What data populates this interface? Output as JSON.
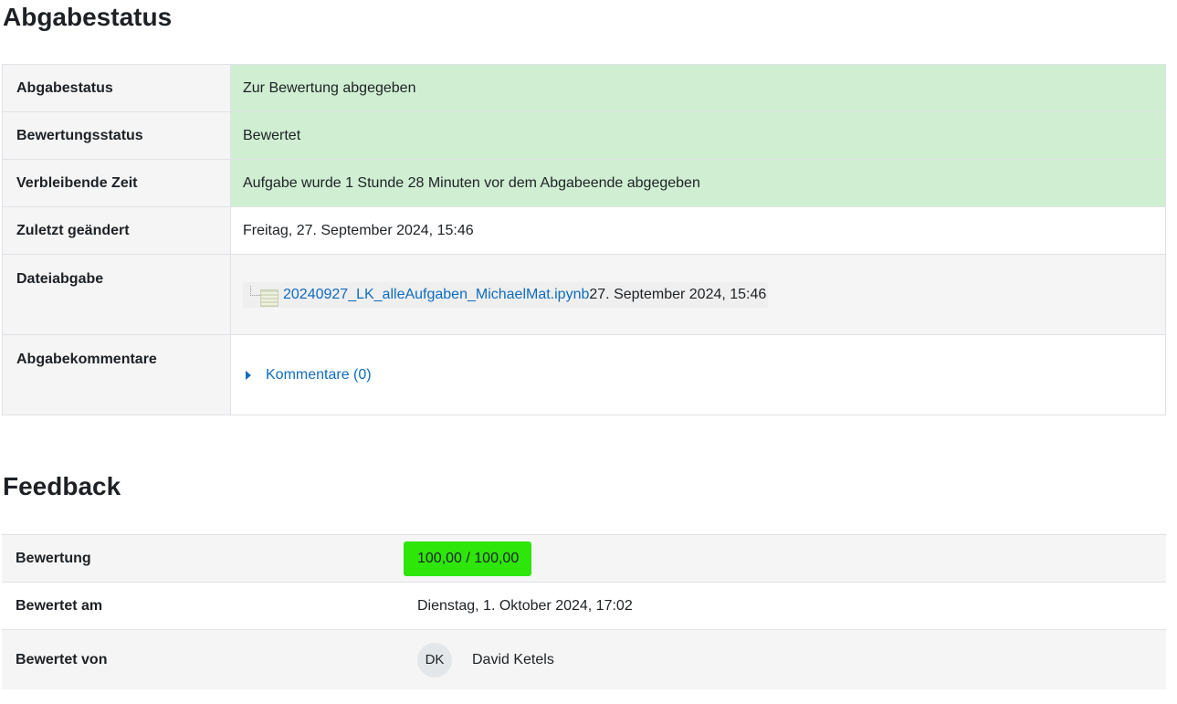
{
  "status_section": {
    "title": "Abgabestatus",
    "rows": [
      {
        "label": "Abgabestatus",
        "value": "Zur Bewertung abgegeben"
      },
      {
        "label": "Bewertungsstatus",
        "value": "Bewertet"
      },
      {
        "label": "Verbleibende Zeit",
        "value": "Aufgabe wurde 1 Stunde 28 Minuten vor dem Abgabeende abgegeben"
      },
      {
        "label": "Zuletzt geändert",
        "value": "Freitag, 27. September 2024, 15:46"
      },
      {
        "label": "Dateiabgabe",
        "file_name": "20240927_LK_alleAufgaben_MichaelMat.ipynb",
        "file_date": "27. September 2024, 15:46",
        "icon": "file-icon"
      },
      {
        "label": "Abgabekommentare",
        "comments_link": "Kommentare (0)",
        "icon": "caret-right-icon"
      }
    ],
    "colors": {
      "success_bg": "#d0eed2",
      "link": "#0f6cbf"
    }
  },
  "feedback_section": {
    "title": "Feedback",
    "rows": [
      {
        "label": "Bewertung",
        "value": "100,00 / 100,00"
      },
      {
        "label": "Bewertet am",
        "value": "Dienstag, 1. Oktober 2024, 17:02"
      },
      {
        "label": "Bewertet von",
        "avatar_initials": "DK",
        "name": "David Ketels"
      }
    ],
    "colors": {
      "highlight": "#2ee60a"
    }
  }
}
